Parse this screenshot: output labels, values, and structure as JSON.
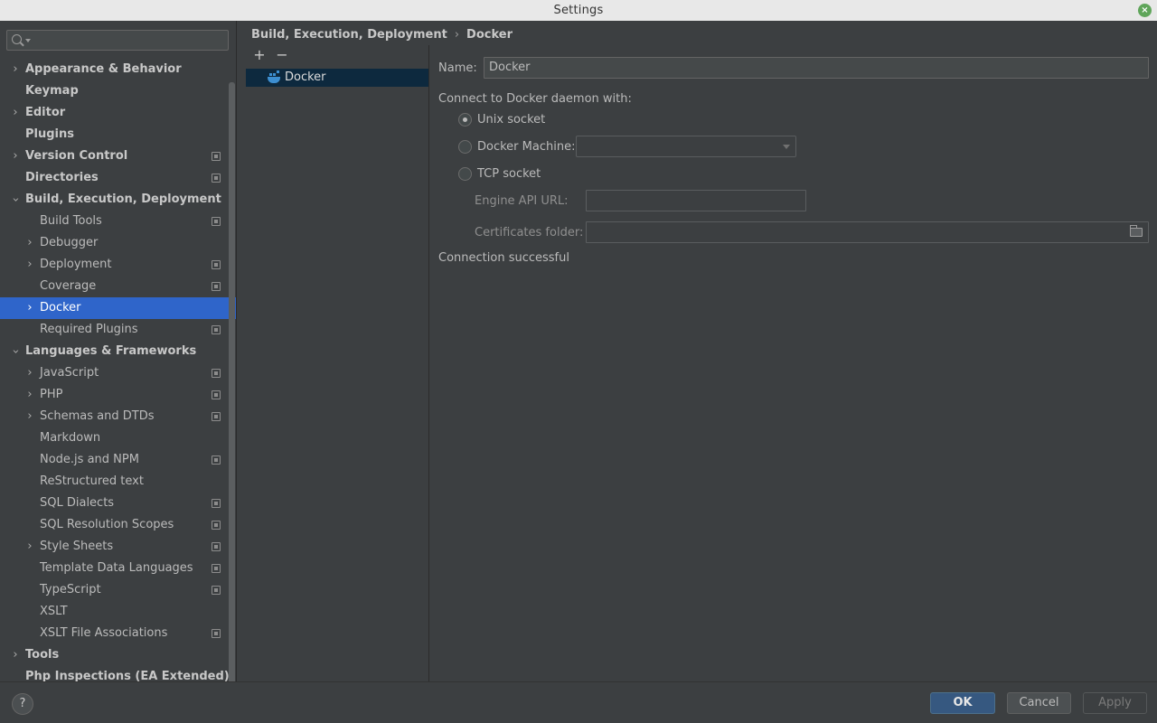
{
  "window": {
    "title": "Settings"
  },
  "search": {
    "value": ""
  },
  "tree": [
    {
      "label": "Appearance & Behavior",
      "level": 0,
      "arrow": "collapsed",
      "project": false,
      "selected": false
    },
    {
      "label": "Keymap",
      "level": 0,
      "arrow": "none",
      "project": false,
      "selected": false
    },
    {
      "label": "Editor",
      "level": 0,
      "arrow": "collapsed",
      "project": false,
      "selected": false
    },
    {
      "label": "Plugins",
      "level": 0,
      "arrow": "none",
      "project": false,
      "selected": false
    },
    {
      "label": "Version Control",
      "level": 0,
      "arrow": "collapsed",
      "project": true,
      "selected": false
    },
    {
      "label": "Directories",
      "level": 0,
      "arrow": "none",
      "project": true,
      "selected": false
    },
    {
      "label": "Build, Execution, Deployment",
      "level": 0,
      "arrow": "expanded",
      "project": false,
      "selected": false
    },
    {
      "label": "Build Tools",
      "level": 1,
      "arrow": "none",
      "project": true,
      "selected": false
    },
    {
      "label": "Debugger",
      "level": 1,
      "arrow": "collapsed",
      "project": false,
      "selected": false
    },
    {
      "label": "Deployment",
      "level": 1,
      "arrow": "collapsed",
      "project": true,
      "selected": false
    },
    {
      "label": "Coverage",
      "level": 1,
      "arrow": "none",
      "project": true,
      "selected": false
    },
    {
      "label": "Docker",
      "level": 1,
      "arrow": "collapsed",
      "project": false,
      "selected": true
    },
    {
      "label": "Required Plugins",
      "level": 1,
      "arrow": "none",
      "project": true,
      "selected": false
    },
    {
      "label": "Languages & Frameworks",
      "level": 0,
      "arrow": "expanded",
      "project": false,
      "selected": false
    },
    {
      "label": "JavaScript",
      "level": 1,
      "arrow": "collapsed",
      "project": true,
      "selected": false
    },
    {
      "label": "PHP",
      "level": 1,
      "arrow": "collapsed",
      "project": true,
      "selected": false
    },
    {
      "label": "Schemas and DTDs",
      "level": 1,
      "arrow": "collapsed",
      "project": true,
      "selected": false
    },
    {
      "label": "Markdown",
      "level": 1,
      "arrow": "none",
      "project": false,
      "selected": false
    },
    {
      "label": "Node.js and NPM",
      "level": 1,
      "arrow": "none",
      "project": true,
      "selected": false
    },
    {
      "label": "ReStructured text",
      "level": 1,
      "arrow": "none",
      "project": false,
      "selected": false
    },
    {
      "label": "SQL Dialects",
      "level": 1,
      "arrow": "none",
      "project": true,
      "selected": false
    },
    {
      "label": "SQL Resolution Scopes",
      "level": 1,
      "arrow": "none",
      "project": true,
      "selected": false
    },
    {
      "label": "Style Sheets",
      "level": 1,
      "arrow": "collapsed",
      "project": true,
      "selected": false
    },
    {
      "label": "Template Data Languages",
      "level": 1,
      "arrow": "none",
      "project": true,
      "selected": false
    },
    {
      "label": "TypeScript",
      "level": 1,
      "arrow": "none",
      "project": true,
      "selected": false
    },
    {
      "label": "XSLT",
      "level": 1,
      "arrow": "none",
      "project": false,
      "selected": false
    },
    {
      "label": "XSLT File Associations",
      "level": 1,
      "arrow": "none",
      "project": true,
      "selected": false
    },
    {
      "label": "Tools",
      "level": 0,
      "arrow": "collapsed",
      "project": false,
      "selected": false
    },
    {
      "label": "Php Inspections (EA Extended)",
      "level": 0,
      "arrow": "none",
      "project": false,
      "selected": false
    }
  ],
  "breadcrumb": {
    "parent": "Build, Execution, Deployment",
    "separator": "›",
    "current": "Docker"
  },
  "list": {
    "add_label": "+",
    "remove_label": "−",
    "items": [
      {
        "label": "Docker"
      }
    ]
  },
  "form": {
    "name_label": "Name:",
    "name_value": "Docker",
    "connect_label": "Connect to Docker daemon with:",
    "unix_label": "Unix socket",
    "unix_checked": true,
    "machine_label": "Docker Machine:",
    "machine_value": "",
    "tcp_label": "TCP socket",
    "api_url_label": "Engine API URL:",
    "api_url_value": "",
    "certs_label": "Certificates folder:",
    "certs_value": "",
    "status": "Connection successful"
  },
  "footer": {
    "help": "?",
    "ok": "OK",
    "cancel": "Cancel",
    "apply": "Apply"
  }
}
